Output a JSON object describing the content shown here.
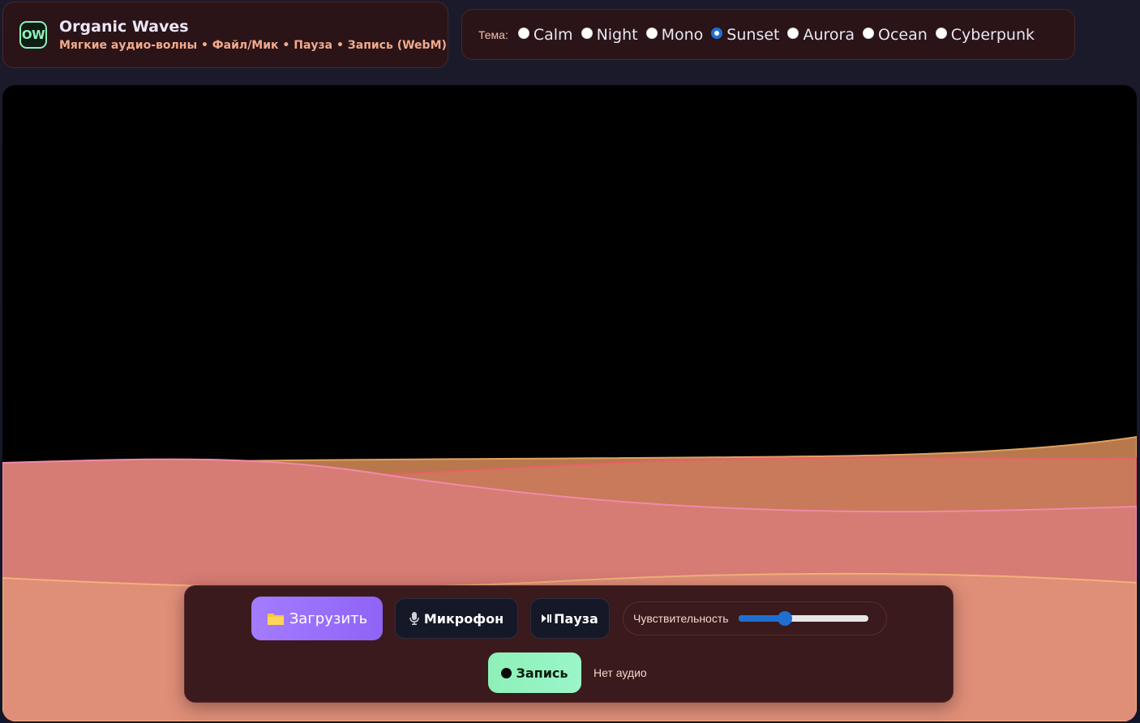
{
  "app": {
    "logo_text": "OW",
    "title": "Organic Waves",
    "subtitle": "Мягкие аудио-волны • Файл/Мик • Пауза • Запись (WebM)"
  },
  "themes": {
    "label": "Тема:",
    "options": [
      {
        "label": "Calm",
        "checked": false
      },
      {
        "label": "Night",
        "checked": false
      },
      {
        "label": "Mono",
        "checked": false
      },
      {
        "label": "Sunset",
        "checked": true
      },
      {
        "label": "Aurora",
        "checked": false
      },
      {
        "label": "Ocean",
        "checked": false
      },
      {
        "label": "Cyberpunk",
        "checked": false
      }
    ]
  },
  "controls": {
    "upload_label": "Загрузить",
    "upload_icon": "folder-icon",
    "mic_label": "Микрофон",
    "mic_icon": "microphone-icon",
    "pause_label": "Пауза",
    "pause_icon": "play-pause-icon",
    "sensitivity_label": "Чувствительность",
    "sensitivity_value": 0.36,
    "record_label": "Запись",
    "record_icon": "record-dot-icon",
    "status_text": "Нет аудио"
  },
  "colors": {
    "accent_purple": "#9a72fb",
    "accent_green": "#8ef0b8",
    "panel_bg": "#3a1a1c",
    "wave_salmon": "#df8e78",
    "wave_coral": "#d27a72",
    "wave_amber": "#c07a50",
    "wave_pink": "#f08aa0"
  }
}
